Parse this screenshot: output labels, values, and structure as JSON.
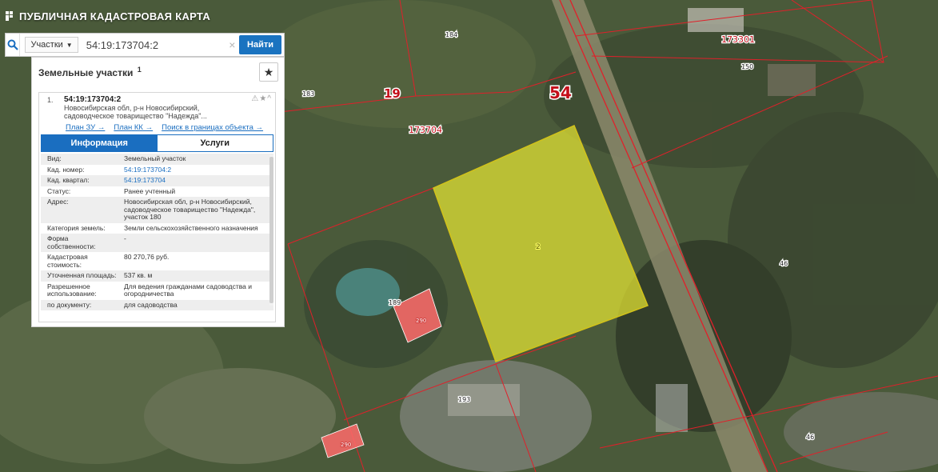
{
  "app": {
    "title": "ПУБЛИЧНАЯ КАДАСТРОВАЯ КАРТА"
  },
  "search": {
    "type_label": "Участки",
    "query": "54:19:173704:2",
    "clear_symbol": "×",
    "find_label": "Найти"
  },
  "panel": {
    "title": "Земельные участки",
    "count": "1",
    "result": {
      "index": "1.",
      "cadastral_number": "54:19:173704:2",
      "address_line1": "Новосибирская обл, р-н Новосибирский,",
      "address_line2": "садоводческое товарищество \"Надежда\"..."
    },
    "links": [
      "План ЗУ →",
      "План КК →",
      "Поиск в границах объекта →"
    ],
    "tabs": [
      "Информация",
      "Услуги"
    ],
    "properties": [
      {
        "label": "Вид:",
        "value": "Земельный участок"
      },
      {
        "label": "Кад. номер:",
        "value": "54:19:173704:2"
      },
      {
        "label": "Кад. квартал:",
        "value": "54:19:173704"
      },
      {
        "label": "Статус:",
        "value": "Ранее учтенный"
      },
      {
        "label": "Адрес:",
        "value": "Новосибирская обл, р-н Новосибирский, садоводческое товарищество \"Надежда\", участок 180"
      },
      {
        "label": "Категория земель:",
        "value": "Земли сельскохозяйственного назначения"
      },
      {
        "label": "Форма собственности:",
        "value": "-"
      },
      {
        "label": "Кадастровая стоимость:",
        "value": "80 270,76 руб."
      },
      {
        "label": "Уточненная площадь:",
        "value": "537 кв. м"
      },
      {
        "label": "Разрешенное использование:",
        "value": "Для ведения гражданами садоводства и огородничества"
      },
      {
        "label": "по документу:",
        "value": "для садоводства"
      }
    ]
  },
  "map": {
    "labels": {
      "region": "54",
      "district": "19",
      "quarter": "173704",
      "quarter_ne": "173301",
      "parcel_selected": "2",
      "p184": "184",
      "p183": "183",
      "p150": "150",
      "p46a": "46",
      "p46b": "46",
      "p189": "189",
      "p290a": "290",
      "p290b": "290",
      "p193": "193"
    },
    "colors": {
      "boundary": "#e0202a",
      "selected_fill": "#e6e633",
      "highlight_fill": "#ff6b6b"
    }
  }
}
